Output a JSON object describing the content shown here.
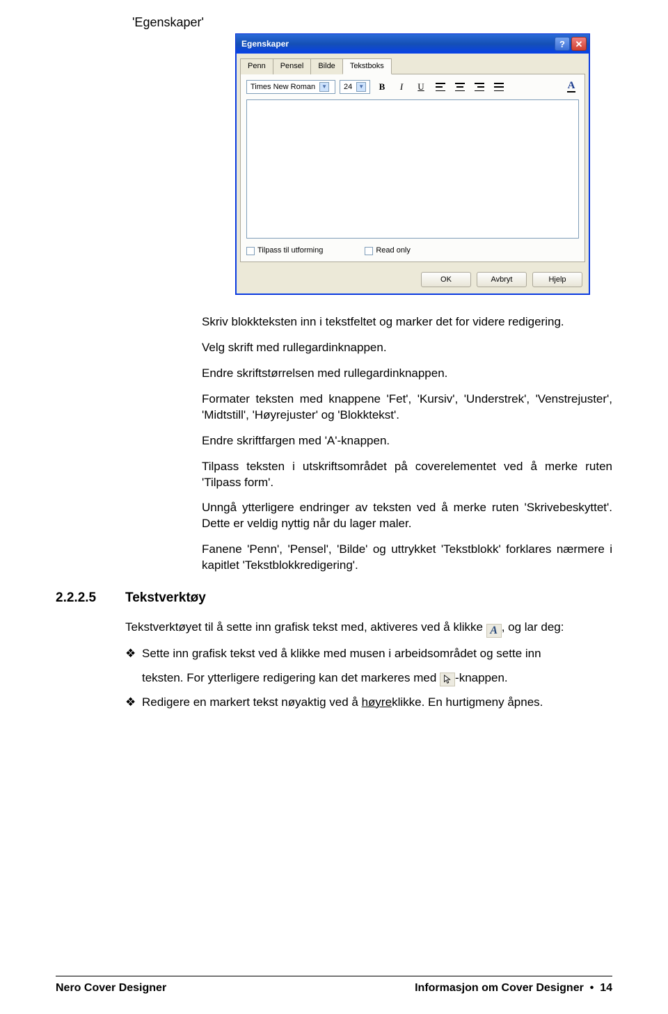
{
  "caption": "'Egenskaper'",
  "dialog": {
    "title": "Egenskaper",
    "help_glyph": "?",
    "close_glyph": "✕",
    "tabs": [
      "Penn",
      "Pensel",
      "Bilde",
      "Tekstboks"
    ],
    "active_tab": "Tekstboks",
    "font_name": "Times New Roman",
    "font_size": "24",
    "bold_label": "B",
    "italic_label": "I",
    "underline_label": "U",
    "color_label": "A",
    "checkbox1": "Tilpass til utforming",
    "checkbox2": "Read only",
    "ok": "OK",
    "cancel": "Avbryt",
    "help": "Hjelp"
  },
  "paragraphs": [
    "Skriv blokkteksten inn i tekstfeltet og marker det for videre redigering.",
    "Velg skrift med rullegardinknappen.",
    "Endre skriftstørrelsen med rullegardinknappen.",
    "Formater teksten med knappene 'Fet', 'Kursiv', 'Understrek', 'Venstrejuster', 'Midtstill', 'Høyrejuster' og 'Blokktekst'.",
    "Endre skriftfargen med 'A'-knappen.",
    "Tilpass teksten i utskriftsområdet på coverelementet ved å merke ruten 'Tilpass form'.",
    "Unngå ytterligere endringer av teksten ved å merke ruten 'Skrivebeskyttet'. Dette er veldig nyttig når du lager maler.",
    "Fanene 'Penn', 'Pensel', 'Bilde' og uttrykket 'Tekstblokk' forklares nærmere i kapitlet 'Tekstblokkredigering'."
  ],
  "section": {
    "num": "2.2.2.5",
    "title": "Tekstverktøy"
  },
  "line_a_pre": "Tekstverktøyet til å sette inn grafisk tekst med, aktiveres ved å klikke ",
  "line_a_post": ", og lar deg:",
  "bullet1": "Sette inn grafisk tekst ved å klikke med musen i arbeidsområdet og sette inn",
  "line_b_pre": "teksten. For ytterligere redigering kan det markeres med ",
  "line_b_post": "-knappen.",
  "bullet2_pre": "Redigere en markert tekst nøyaktig ved å ",
  "bullet2_underline": "høyre",
  "bullet2_post": "klikke. En hurtigmeny åpnes.",
  "footer": {
    "left": "Nero Cover Designer",
    "right_text": "Informasjon om Cover Designer",
    "bullet": "•",
    "page": "14"
  }
}
